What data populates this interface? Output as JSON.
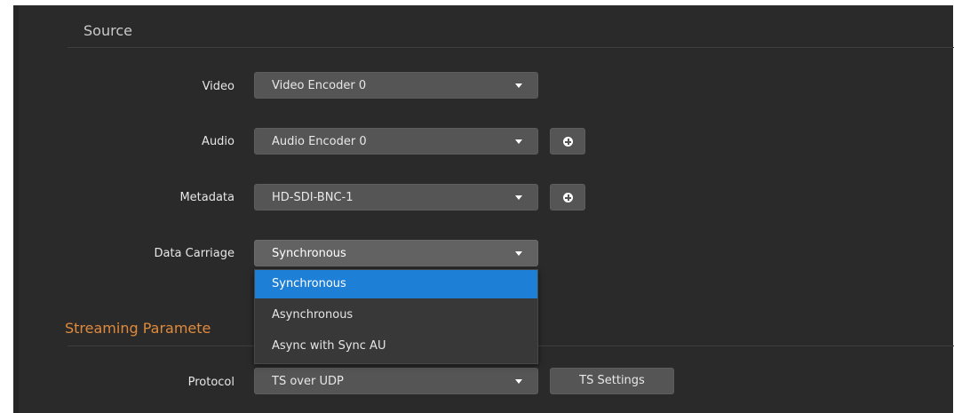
{
  "source": {
    "section_title": "Source",
    "fields": {
      "video": {
        "label": "Video",
        "value": "Video Encoder 0"
      },
      "audio": {
        "label": "Audio",
        "value": "Audio Encoder 0"
      },
      "metadata": {
        "label": "Metadata",
        "value": "HD-SDI-BNC-1"
      },
      "data_carriage": {
        "label": "Data Carriage",
        "value": "Synchronous",
        "options": [
          "Synchronous",
          "Asynchronous",
          "Async with Sync AU"
        ],
        "selected_index": 0
      }
    }
  },
  "streaming": {
    "section_title": "Streaming Paramete",
    "protocol": {
      "label": "Protocol",
      "value": "TS over UDP"
    },
    "ts_settings_label": "TS Settings"
  },
  "colors": {
    "panel_bg": "#2a2a2a",
    "control_bg": "#555555",
    "accent": "#e08a3c",
    "selected": "#1e7fd6"
  }
}
